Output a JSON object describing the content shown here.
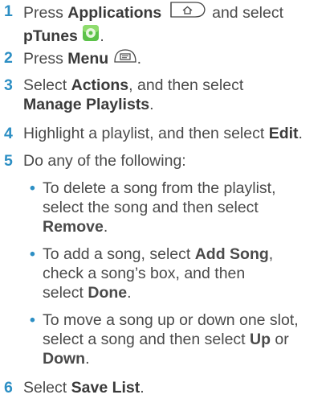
{
  "steps": [
    {
      "num": "1",
      "l1_pre": "Press ",
      "l1_bold": "Applications",
      "l1_post": " and select",
      "l2_bold": "pTunes",
      "l2_post": ".",
      "icons": [
        "applications-key-icon",
        "ptunes-app-icon"
      ]
    },
    {
      "num": "2",
      "pre": "Press ",
      "bold": "Menu",
      "post": ".",
      "icons": [
        "menu-key-icon"
      ]
    },
    {
      "num": "3",
      "l1_pre": "Select ",
      "l1_bold": "Actions",
      "l1_post": ", and then select",
      "l2_bold": "Manage Playlists",
      "l2_post": "."
    },
    {
      "num": "4",
      "pre": "Highlight a playlist, and then select ",
      "bold": "Edit",
      "post": "."
    },
    {
      "num": "5",
      "text": "Do any of the following:",
      "bullets": [
        {
          "l1": "To delete a song from the playlist,",
          "l2": "select the song and then select",
          "l3_bold": "Remove",
          "l3_post": "."
        },
        {
          "l1_pre": "To add a song, select ",
          "l1_bold": "Add Song",
          "l1_post": ",",
          "l2": "check a song’s box, and then",
          "l3_pre": "select ",
          "l3_bold": "Done",
          "l3_post": "."
        },
        {
          "l1": "To move a song up or down one slot,",
          "l2_pre": "select a song and then select ",
          "l2_bold": "Up",
          "l2_post": " or",
          "l3_bold": "Down",
          "l3_post": "."
        }
      ]
    },
    {
      "num": "6",
      "pre": "Select ",
      "bold": "Save List",
      "post": "."
    }
  ],
  "bullet_char": "•",
  "colors": {
    "step_number": "#2d8fc4",
    "body_text": "#4a4a4a",
    "icon_green": "#5cc24a"
  }
}
